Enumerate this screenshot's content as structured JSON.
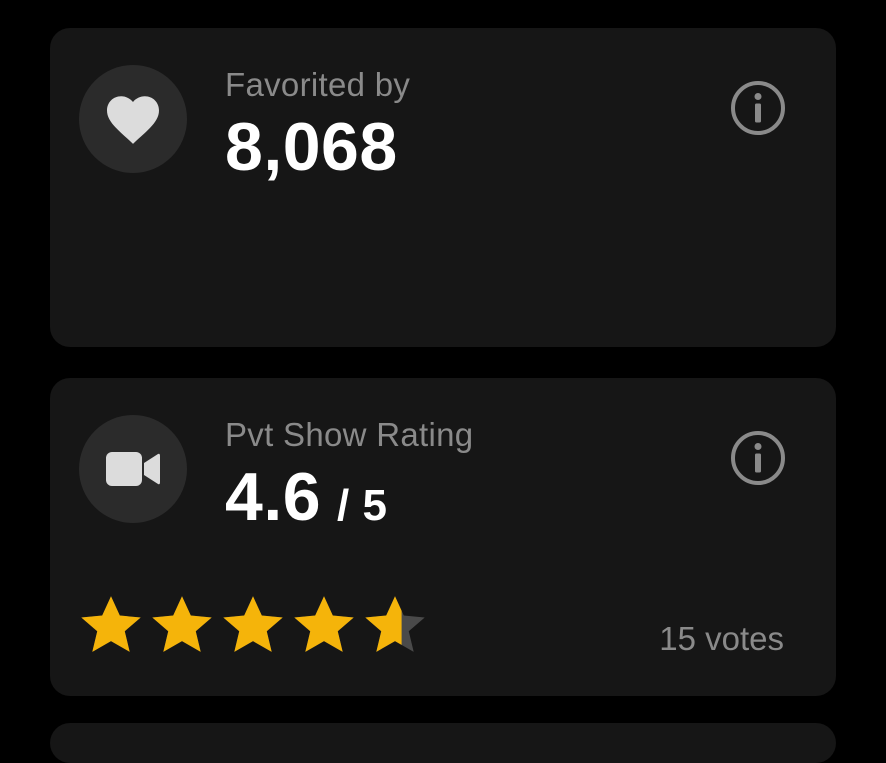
{
  "favorites_card": {
    "label": "Favorited by",
    "value": "8,068",
    "icon": "heart-icon"
  },
  "rating_card": {
    "label": "Pvt Show Rating",
    "value": "4.6",
    "denominator": "/ 5",
    "rating": 4.6,
    "max_rating": 5,
    "votes_text": "15 votes",
    "icon": "video-camera-icon"
  },
  "colors": {
    "background": "#000000",
    "card": "#161616",
    "icon_circle": "#2b2b2b",
    "label": "#8a8a8a",
    "value": "#ffffff",
    "star_filled": "#f5b40a",
    "star_empty": "#4a4a4a"
  }
}
